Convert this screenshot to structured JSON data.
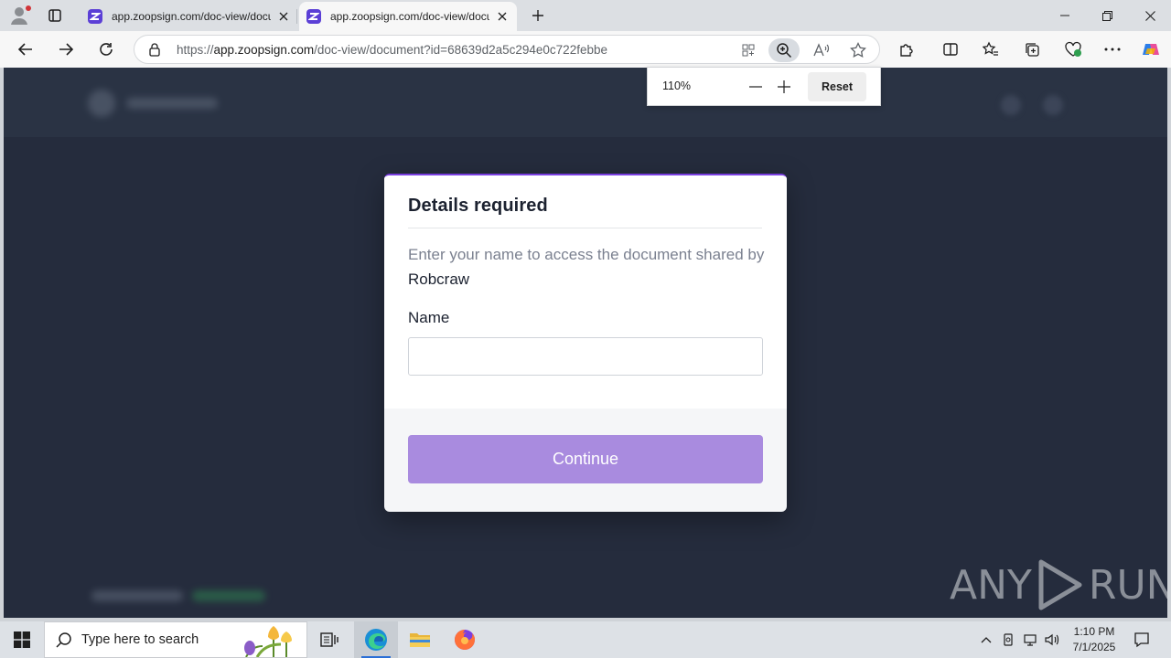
{
  "browser": {
    "tabs": [
      {
        "title": "app.zoopsign.com/doc-view/docu",
        "active": false
      },
      {
        "title": "app.zoopsign.com/doc-view/docu",
        "active": true
      }
    ],
    "url_scheme": "https://",
    "url_host": "app.zoopsign.com",
    "url_path": "/doc-view/document?id=68639d2a5c294e0c722febbe",
    "zoom_popup": {
      "level": "110%",
      "reset_label": "Reset"
    }
  },
  "modal": {
    "title": "Details required",
    "description": "Enter your name to access the document shared by",
    "owner": "Robcraw",
    "name_label": "Name",
    "name_value": "",
    "continue_label": "Continue"
  },
  "watermark": {
    "left": "ANY",
    "right": "RUN"
  },
  "taskbar": {
    "search_placeholder": "Type here to search",
    "time": "1:10 PM",
    "date": "7/1/2025"
  },
  "colors": {
    "accent_purple": "#7a3fe0",
    "button_purple": "#a98bdf",
    "page_background": "#252c3d"
  }
}
